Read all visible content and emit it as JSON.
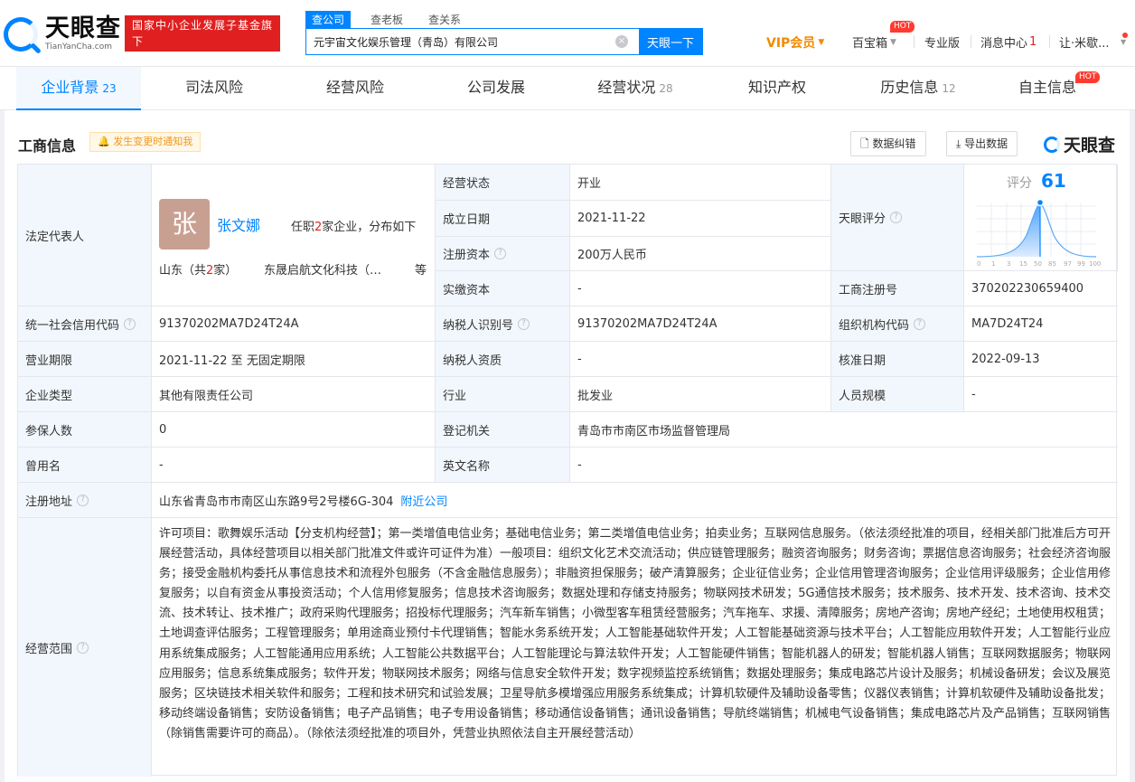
{
  "header": {
    "logo_cn": "天眼查",
    "logo_en": "TianYanCha.com",
    "banner_line1": "国家中小企业发展子基金旗下",
    "banner_line2": "官方备案企业征信机构",
    "search_tabs": [
      "查公司",
      "查老板",
      "查关系"
    ],
    "search_value": "元宇宙文化娱乐管理（青岛）有限公司",
    "search_button": "天眼一下",
    "clear_glyph": "×",
    "vip": "VIP会员",
    "baibao": "百宝箱",
    "hot": "HOT",
    "pro": "专业版",
    "msg": "消息中心",
    "msg_count": "1",
    "user": "让·米歇..."
  },
  "tabs": [
    {
      "label": "企业背景",
      "count": "23"
    },
    {
      "label": "司法风险",
      "count": ""
    },
    {
      "label": "经营风险",
      "count": ""
    },
    {
      "label": "公司发展",
      "count": ""
    },
    {
      "label": "经营状况",
      "count": "28"
    },
    {
      "label": "知识产权",
      "count": ""
    },
    {
      "label": "历史信息",
      "count": "12"
    },
    {
      "label": "自主信息",
      "count": ""
    }
  ],
  "section": {
    "title": "工商信息",
    "notify": "发生变更时通知我",
    "correct": "数据纠错",
    "export": "导出数据",
    "brand": "天眼查"
  },
  "legal": {
    "label": "法定代表人",
    "avatar_char": "张",
    "name": "张文娜",
    "positions_prefix": "任职",
    "positions_count": "2",
    "positions_suffix": "家企业，分布如下",
    "region_prefix": "山东（共",
    "region_count": "2",
    "region_suffix": "家）",
    "company": "东晟启航文化科技（…",
    "more": "等"
  },
  "score": {
    "label": "天眼评分",
    "title": "评分",
    "value": "61",
    "ticks": [
      "0",
      "1",
      "3",
      "15",
      "50",
      "85",
      "97",
      "99",
      "100"
    ]
  },
  "info": {
    "status_label": "经营状态",
    "status": "开业",
    "found_label": "成立日期",
    "found": "2021-11-22",
    "capital_label": "注册资本",
    "capital": "200万人民币",
    "paid_label": "实缴资本",
    "paid": "-",
    "regno_label": "工商注册号",
    "regno": "370202230659400",
    "credit_label": "统一社会信用代码",
    "credit": "91370202MA7D24T24A",
    "taxid_label": "纳税人识别号",
    "taxid": "91370202MA7D24T24A",
    "orgcode_label": "组织机构代码",
    "orgcode": "MA7D24T24",
    "term_label": "营业期限",
    "term": "2021-11-22 至 无固定期限",
    "taxq_label": "纳税人资质",
    "taxq": "-",
    "approve_label": "核准日期",
    "approve": "2022-09-13",
    "type_label": "企业类型",
    "type": "其他有限责任公司",
    "industry_label": "行业",
    "industry": "批发业",
    "staff_label": "人员规模",
    "staff": "-",
    "insured_label": "参保人数",
    "insured": "0",
    "authority_label": "登记机关",
    "authority": "青岛市市南区市场监督管理局",
    "former_label": "曾用名",
    "former": "-",
    "english_label": "英文名称",
    "english": "-",
    "address_label": "注册地址",
    "address": "山东省青岛市市南区山东路9号2号楼6G-304",
    "nearby": "附近公司",
    "scope_label": "经营范围",
    "scope": "许可项目：歌舞娱乐活动【分支机构经营】；第一类增值电信业务；基础电信业务；第二类增值电信业务；拍卖业务；互联网信息服务。（依法须经批准的项目，经相关部门批准后方可开展经营活动，具体经营项目以相关部门批准文件或许可证件为准）一般项目：组织文化艺术交流活动；供应链管理服务；融资咨询服务；财务咨询；票据信息咨询服务；社会经济咨询服务；接受金融机构委托从事信息技术和流程外包服务（不含金融信息服务）；非融资担保服务；破产清算服务；企业征信业务；企业信用管理咨询服务；企业信用评级服务；企业信用修复服务；以自有资金从事投资活动；个人信用修复服务；信息技术咨询服务；数据处理和存储支持服务；物联网技术研发；5G通信技术服务；技术服务、技术开发、技术咨询、技术交流、技术转让、技术推广；政府采购代理服务；招投标代理服务；汽车新车销售；小微型客车租赁经营服务；汽车拖车、求援、清障服务；房地产咨询；房地产经纪；土地使用权租赁；土地调查评估服务；工程管理服务；单用途商业预付卡代理销售；智能水务系统开发；人工智能基础软件开发；人工智能基础资源与技术平台；人工智能应用软件开发；人工智能行业应用系统集成服务；人工智能通用应用系统；人工智能公共数据平台；人工智能理论与算法软件开发；人工智能硬件销售；智能机器人的研发；智能机器人销售；互联网数据服务；物联网应用服务；信息系统集成服务；软件开发；物联网技术服务；网络与信息安全软件开发；数字视频监控系统销售；数据处理服务；集成电路芯片设计及服务；机械设备研发；会议及展览服务；区块链技术相关软件和服务；工程和技术研究和试验发展；卫星导航多模增强应用服务系统集成；计算机软硬件及辅助设备零售；仪器仪表销售；计算机软硬件及辅助设备批发；移动终端设备销售；安防设备销售；电子产品销售；电子专用设备销售；移动通信设备销售；通讯设备销售；导航终端销售；机械电气设备销售；集成电路芯片及产品销售；互联网销售（除销售需要许可的商品）。（除依法须经批准的项目外，凭营业执照依法自主开展经营活动）"
  },
  "colors": {
    "accent": "#0084ff",
    "red": "#e02020",
    "label_bg": "#f2f7fd"
  }
}
